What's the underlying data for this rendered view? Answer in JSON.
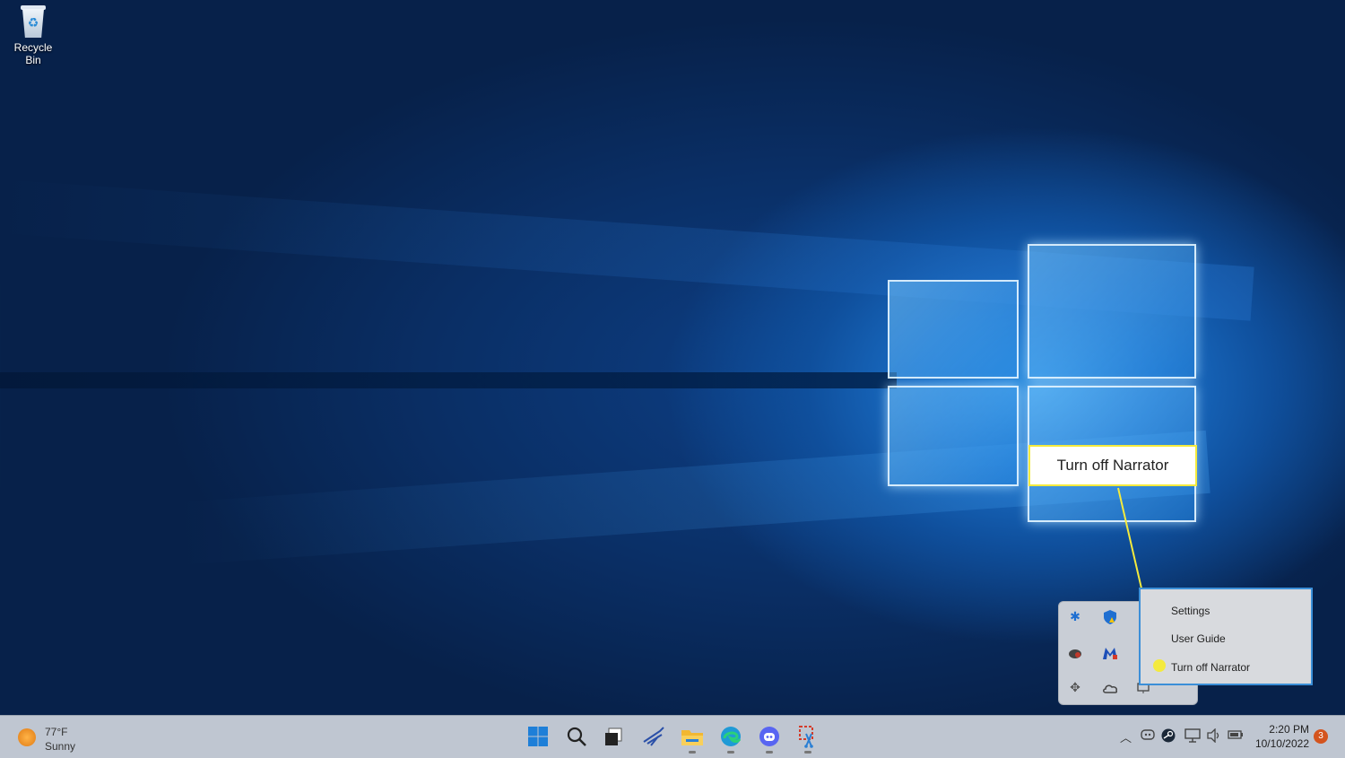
{
  "desktop": {
    "icons": [
      {
        "label": "Recycle Bin",
        "icon": "recycle-bin-icon"
      }
    ]
  },
  "callout": {
    "text": "Turn off Narrator"
  },
  "context_menu": {
    "items": [
      "Settings",
      "User Guide",
      "Turn off Narrator"
    ]
  },
  "tray_flyout": {
    "icons": [
      "bluetooth-icon",
      "security-shield-icon",
      "app-tray-icon",
      "malwarebytes-icon",
      "puzzle-icon",
      "onedrive-icon",
      "narrator-icon"
    ]
  },
  "weather": {
    "temperature": "77°F",
    "condition": "Sunny"
  },
  "taskbar": {
    "pinned": [
      "start-icon",
      "search-icon",
      "task-view-icon",
      "app-icon",
      "file-explorer-icon",
      "edge-icon",
      "discord-icon",
      "snipping-tool-icon"
    ],
    "system_tray": [
      "chevron-up-icon",
      "discord-tray-icon",
      "steam-icon",
      "display-icon",
      "volume-icon",
      "battery-icon"
    ]
  },
  "clock": {
    "time": "2:20 PM",
    "date": "10/10/2022"
  },
  "notifications": {
    "count": "3"
  },
  "colors": {
    "callout_border": "#f4ea3d",
    "menu_border": "#3b8fd8",
    "taskbar": "#bfc6d1"
  }
}
